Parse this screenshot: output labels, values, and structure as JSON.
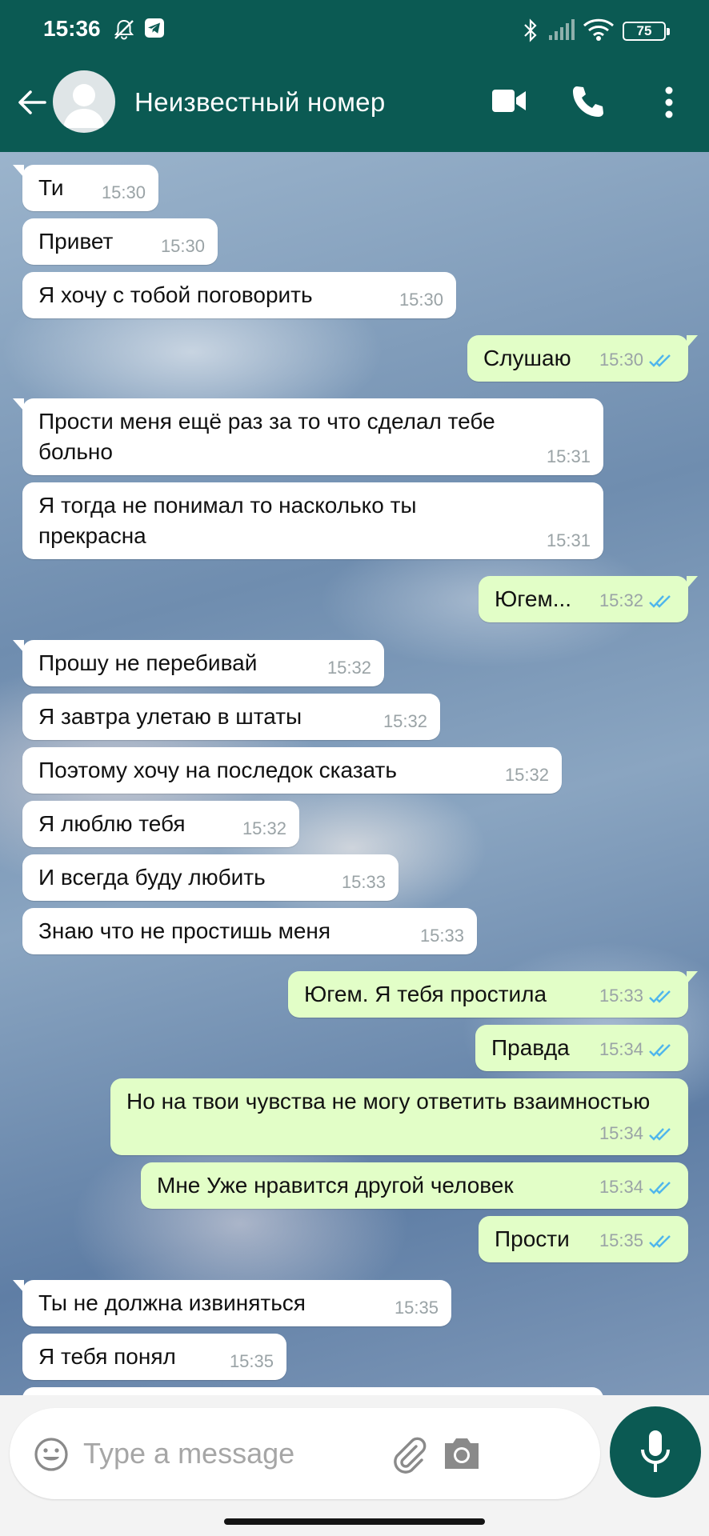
{
  "status": {
    "time": "15:36",
    "battery": "75"
  },
  "header": {
    "contact_name": "Неизвестный номер"
  },
  "messages": [
    {
      "text": "Ти",
      "time": "15:30",
      "dir": "in"
    },
    {
      "text": "Привет",
      "time": "15:30",
      "dir": "in"
    },
    {
      "text": "Я хочу с тобой поговорить",
      "time": "15:30",
      "dir": "in"
    },
    {
      "text": "Слушаю",
      "time": "15:30",
      "dir": "out"
    },
    {
      "text": "Прости меня ещё раз за то что сделал тебе больно",
      "time": "15:31",
      "dir": "in"
    },
    {
      "text": "Я тогда не понимал то насколько ты прекрасна",
      "time": "15:31",
      "dir": "in"
    },
    {
      "text": "Югем...",
      "time": "15:32",
      "dir": "out"
    },
    {
      "text": "Прошу не перебивай",
      "time": "15:32",
      "dir": "in"
    },
    {
      "text": "Я завтра улетаю в штаты",
      "time": "15:32",
      "dir": "in"
    },
    {
      "text": "Поэтому хочу на последок сказать",
      "time": "15:32",
      "dir": "in"
    },
    {
      "text": "Я люблю тебя",
      "time": "15:32",
      "dir": "in"
    },
    {
      "text": "И всегда буду любить",
      "time": "15:33",
      "dir": "in"
    },
    {
      "text": "Знаю что не простишь меня",
      "time": "15:33",
      "dir": "in"
    },
    {
      "text": "Югем. Я тебя простила",
      "time": "15:33",
      "dir": "out"
    },
    {
      "text": "Правда",
      "time": "15:34",
      "dir": "out"
    },
    {
      "text": "Но на твои чувства не могу ответить взаимностью",
      "time": "15:34",
      "dir": "out"
    },
    {
      "text": "Мне Уже нравится другой человек",
      "time": "15:34",
      "dir": "out"
    },
    {
      "text": "Прости",
      "time": "15:35",
      "dir": "out"
    },
    {
      "text": "Ты не должна извиняться",
      "time": "15:35",
      "dir": "in"
    },
    {
      "text": "Я тебя понял",
      "time": "15:35",
      "dir": "in"
    }
  ],
  "composer": {
    "placeholder": "Type a message"
  },
  "icons": {
    "status": [
      "mute-bell-icon",
      "telegram-icon",
      "bluetooth-icon",
      "signal-icon",
      "wifi-icon",
      "battery-icon"
    ],
    "header": [
      "back-arrow-icon",
      "avatar",
      "video-call-icon",
      "voice-call-icon",
      "more-vert-icon"
    ],
    "composer": [
      "emoji-icon",
      "attach-icon",
      "camera-icon",
      "mic-icon"
    ]
  },
  "colors": {
    "header": "#0b5a53",
    "incoming_bubble": "#ffffff",
    "outgoing_bubble": "#e2fec7",
    "read_ticks": "#4fb6ec",
    "timestamp": "#9aa3a6"
  }
}
